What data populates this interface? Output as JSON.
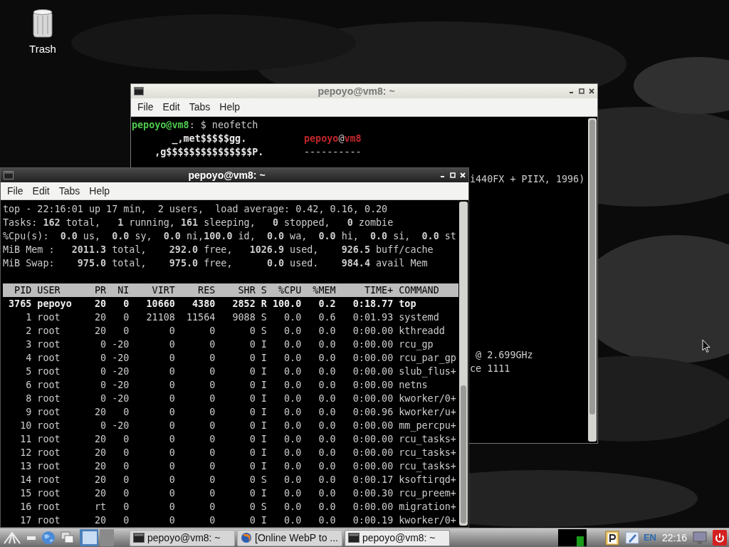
{
  "desktop": {
    "icons": [
      {
        "label": "Trash"
      }
    ]
  },
  "back_terminal": {
    "title": "pepoyo@vm8: ~",
    "active": false,
    "menu": [
      "File",
      "Edit",
      "Tabs",
      "Help"
    ],
    "lines": [
      {
        "info": [
          {
            "kind": "user",
            "text": "pepoyo@vm8"
          },
          {
            "kind": "plain",
            "text": ": $ neofetch"
          }
        ]
      },
      {
        "art": "       _,met$$$$$gg.",
        "info": [
          {
            "kind": "label",
            "text": "pepoyo"
          },
          {
            "kind": "plain",
            "text": "@"
          },
          {
            "kind": "label",
            "text": "vm8"
          }
        ]
      },
      {
        "art": "    ,g$$$$$$$$$$$$$$$P.",
        "info": [
          {
            "kind": "plain",
            "text": "----------"
          }
        ]
      }
    ],
    "right_lines": [
      {
        "tail": "i440FX + PIIX, 1996)"
      }
    ],
    "lower_lines": [
      {
        "tail": " @ 2.699GHz"
      },
      {
        "tail": "ce 1111"
      }
    ]
  },
  "front_terminal": {
    "title": "pepoyo@vm8: ~",
    "active": true,
    "menu": [
      "File",
      "Edit",
      "Tabs",
      "Help"
    ],
    "summary": [
      "top - 22:16:01 up 17 min,  2 users,  load average: 0.42, 0.16, 0.20",
      "Tasks: **162** total,   **1** running, **161** sleeping,   **0** stopped,   **0** zombie",
      "%Cpu(s):  **0.0** us,  **0.0** sy,  **0.0** ni,**100.0** id,  **0.0** wa,  **0.0** hi,  **0.0** si,  **0.0** st",
      "MiB Mem :   **2011.3** total,    **292.0** free,   **1026.9** used,    **926.5** buff/cache",
      "MiB Swap:    **975.0** total,    **975.0** free,      **0.0** used.    **984.4** avail Mem"
    ],
    "header": "  PID USER      PR  NI    VIRT    RES    SHR S  %CPU  %MEM     TIME+ COMMAND",
    "rows": [
      {
        "text": " 3765 pepoyo    20   0   10660   4380   2852 R 100.0   0.2   0:18.77 top",
        "current": true
      },
      {
        "text": "    1 root      20   0   21108  11564   9088 S   0.0   0.6   0:01.93 systemd",
        "current": false
      },
      {
        "text": "    2 root      20   0       0      0      0 S   0.0   0.0   0:00.00 kthreadd",
        "current": false
      },
      {
        "text": "    3 root       0 -20       0      0      0 I   0.0   0.0   0:00.00 rcu_gp",
        "current": false
      },
      {
        "text": "    4 root       0 -20       0      0      0 I   0.0   0.0   0:00.00 rcu_par_gp",
        "current": false
      },
      {
        "text": "    5 root       0 -20       0      0      0 I   0.0   0.0   0:00.00 slub_flus+",
        "current": false
      },
      {
        "text": "    6 root       0 -20       0      0      0 I   0.0   0.0   0:00.00 netns",
        "current": false
      },
      {
        "text": "    8 root       0 -20       0      0      0 I   0.0   0.0   0:00.00 kworker/0+",
        "current": false
      },
      {
        "text": "    9 root      20   0       0      0      0 I   0.0   0.0   0:00.96 kworker/u+",
        "current": false
      },
      {
        "text": "   10 root       0 -20       0      0      0 I   0.0   0.0   0:00.00 mm_percpu+",
        "current": false
      },
      {
        "text": "   11 root      20   0       0      0      0 I   0.0   0.0   0:00.00 rcu_tasks+",
        "current": false
      },
      {
        "text": "   12 root      20   0       0      0      0 I   0.0   0.0   0:00.00 rcu_tasks+",
        "current": false
      },
      {
        "text": "   13 root      20   0       0      0      0 I   0.0   0.0   0:00.00 rcu_tasks+",
        "current": false
      },
      {
        "text": "   14 root      20   0       0      0      0 S   0.0   0.0   0:00.17 ksoftirqd+",
        "current": false
      },
      {
        "text": "   15 root      20   0       0      0      0 I   0.0   0.0   0:00.30 rcu_preem+",
        "current": false
      },
      {
        "text": "   16 root      rt   0       0      0      0 S   0.0   0.0   0:00.00 migration+",
        "current": false
      },
      {
        "text": "   17 root      20   0       0      0      0 I   0.0   0.0   0:00.19 kworker/0+",
        "current": false
      }
    ]
  },
  "taskbar": {
    "tasks": [
      {
        "kind": "terminal",
        "label": "pepoyo@vm8: ~",
        "selected": false
      },
      {
        "kind": "browser",
        "label": "[Online WebP to ...",
        "selected": false
      },
      {
        "kind": "terminal",
        "label": "pepoyo@vm8: ~",
        "selected": true
      }
    ],
    "keyboard": "EN",
    "clock": "22:16"
  }
}
